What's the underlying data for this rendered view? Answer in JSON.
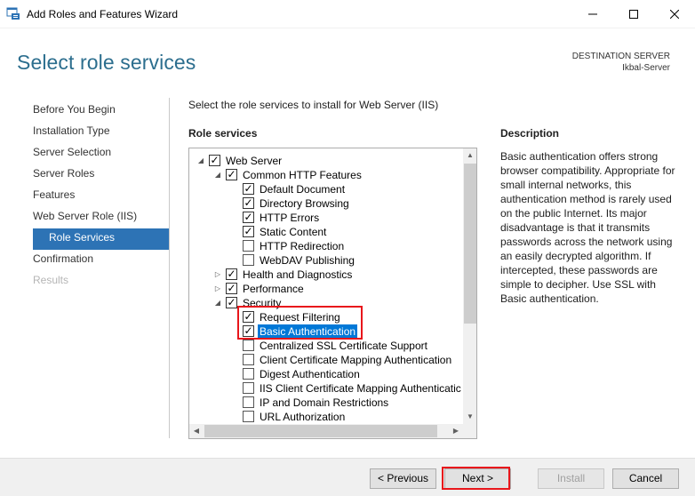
{
  "window": {
    "title": "Add Roles and Features Wizard",
    "controls": {
      "minimize": "—",
      "maximize": "☐",
      "close": "✕"
    }
  },
  "header": {
    "page_title": "Select role services",
    "destination_label": "DESTINATION SERVER",
    "destination_server": "Ikbal-Server"
  },
  "nav": {
    "items": [
      {
        "label": "Before You Begin",
        "state": "normal"
      },
      {
        "label": "Installation Type",
        "state": "normal"
      },
      {
        "label": "Server Selection",
        "state": "normal"
      },
      {
        "label": "Server Roles",
        "state": "normal"
      },
      {
        "label": "Features",
        "state": "normal"
      },
      {
        "label": "Web Server Role (IIS)",
        "state": "normal"
      },
      {
        "label": "Role Services",
        "state": "active"
      },
      {
        "label": "Confirmation",
        "state": "normal"
      },
      {
        "label": "Results",
        "state": "disabled"
      }
    ]
  },
  "main": {
    "instruction": "Select the role services to install for Web Server (IIS)",
    "role_services_header": "Role services",
    "tree": [
      {
        "label": "Web Server",
        "level": 0,
        "expander": "expanded",
        "checked": true
      },
      {
        "label": "Common HTTP Features",
        "level": 1,
        "expander": "expanded",
        "checked": true
      },
      {
        "label": "Default Document",
        "level": 2,
        "expander": "none",
        "checked": true
      },
      {
        "label": "Directory Browsing",
        "level": 2,
        "expander": "none",
        "checked": true
      },
      {
        "label": "HTTP Errors",
        "level": 2,
        "expander": "none",
        "checked": true
      },
      {
        "label": "Static Content",
        "level": 2,
        "expander": "none",
        "checked": true
      },
      {
        "label": "HTTP Redirection",
        "level": 2,
        "expander": "none",
        "checked": false
      },
      {
        "label": "WebDAV Publishing",
        "level": 2,
        "expander": "none",
        "checked": false
      },
      {
        "label": "Health and Diagnostics",
        "level": 1,
        "expander": "collapsed",
        "checked": true
      },
      {
        "label": "Performance",
        "level": 1,
        "expander": "collapsed",
        "checked": true
      },
      {
        "label": "Security",
        "level": 1,
        "expander": "expanded",
        "checked": true
      },
      {
        "label": "Request Filtering",
        "level": 2,
        "expander": "none",
        "checked": true
      },
      {
        "label": "Basic Authentication",
        "level": 2,
        "expander": "none",
        "checked": true,
        "selected": true
      },
      {
        "label": "Centralized SSL Certificate Support",
        "level": 2,
        "expander": "none",
        "checked": false
      },
      {
        "label": "Client Certificate Mapping Authentication",
        "level": 2,
        "expander": "none",
        "checked": false
      },
      {
        "label": "Digest Authentication",
        "level": 2,
        "expander": "none",
        "checked": false
      },
      {
        "label": "IIS Client Certificate Mapping Authenticatic",
        "level": 2,
        "expander": "none",
        "checked": false
      },
      {
        "label": "IP and Domain Restrictions",
        "level": 2,
        "expander": "none",
        "checked": false
      },
      {
        "label": "URL Authorization",
        "level": 2,
        "expander": "none",
        "checked": false
      }
    ]
  },
  "description": {
    "header": "Description",
    "text": "Basic authentication offers strong browser compatibility. Appropriate for small internal networks, this authentication method is rarely used on the public Internet. Its major disadvantage is that it transmits passwords across the network using an easily decrypted algorithm. If intercepted, these passwords are simple to decipher. Use SSL with Basic authentication."
  },
  "footer": {
    "previous": "< Previous",
    "next": "Next >",
    "install": "Install",
    "cancel": "Cancel"
  },
  "colors": {
    "accent": "#2d73b5",
    "title": "#2c6e8e",
    "highlight": "#e8161b",
    "selection": "#0078d7"
  }
}
